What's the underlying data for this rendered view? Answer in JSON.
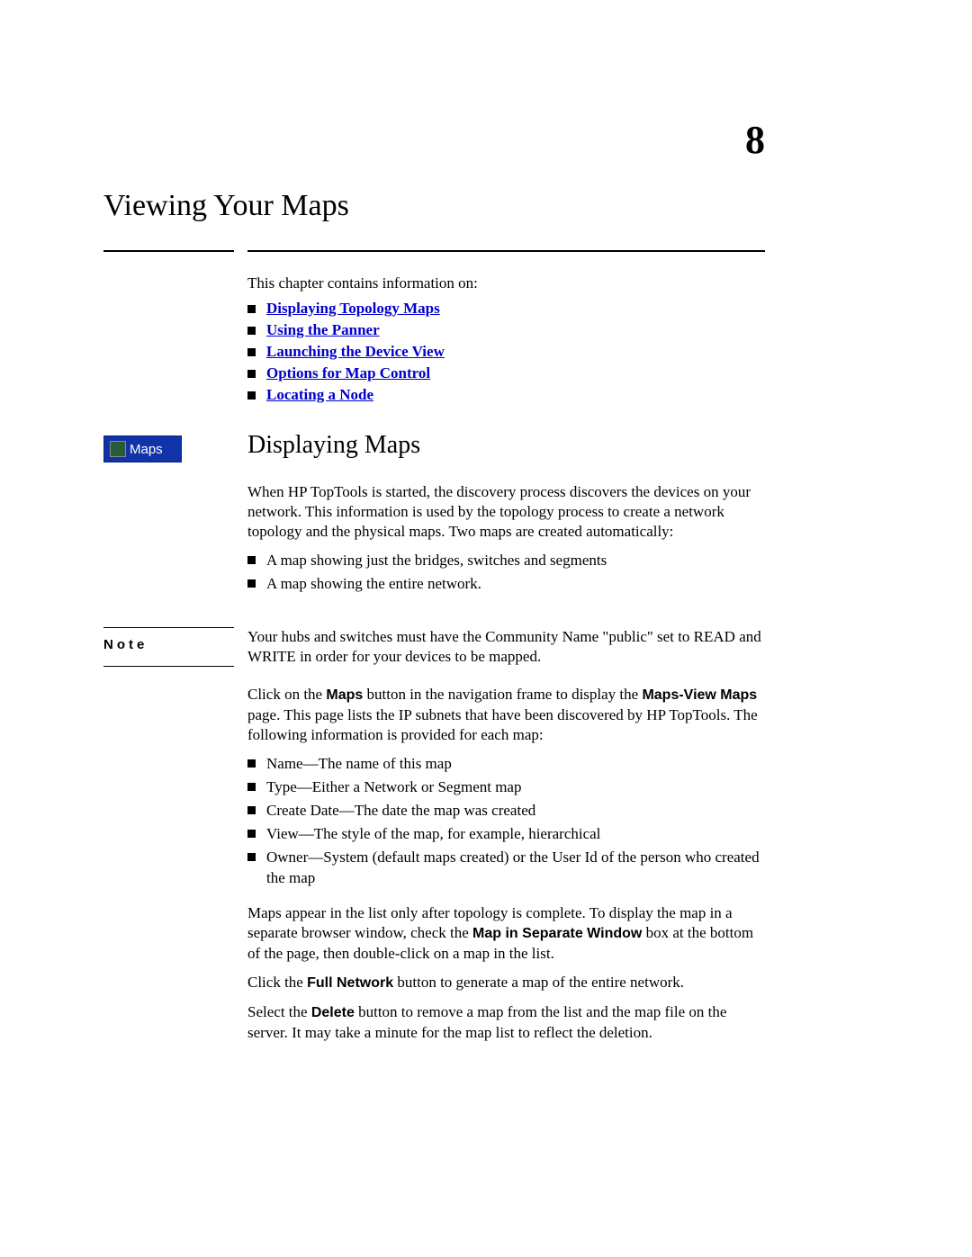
{
  "chapter_number": "8",
  "chapter_title": "Viewing Your Maps",
  "intro": "This chapter contains information on:",
  "links": [
    "Displaying Topology Maps",
    "Using the Panner",
    "Launching the Device View",
    "Options for Map Control",
    "Locating a Node"
  ],
  "section_title": "Displaying Maps",
  "maps_button_label": "Maps",
  "para1": "When HP TopTools is started, the discovery process discovers the devices on your network. This information is used by the topology process to create a network topology and the physical maps. Two maps are created automatically:",
  "list1": [
    "A map showing just the bridges, switches and segments",
    "A map showing the entire network."
  ],
  "note_label": "Note",
  "note_text": "Your hubs and switches must have the Community Name \"public\" set to READ and WRITE in order for your devices to be mapped.",
  "para2_pre": "Click on the ",
  "para2_bold1": "Maps",
  "para2_mid1": " button in the navigation frame to display the ",
  "para2_bold2": "Maps-View Maps",
  "para2_post": " page. This page lists the IP subnets that have been discovered by HP TopTools. The following information is provided for each map:",
  "list2": [
    "Name—The name of this map",
    "Type—Either a Network or Segment map",
    "Create Date—The date the map was created",
    "View—The style of the map, for example, hierarchical",
    "Owner—System (default maps created) or the User Id of the person who created the map"
  ],
  "para3_pre": "Maps appear in the list only after topology is complete. To display the map in a separate browser window, check the ",
  "para3_bold": "Map in Separate Window",
  "para3_post": " box at the bottom of the page, then double-click on a map in the list.",
  "para4_pre": "Click the ",
  "para4_bold": "Full Network",
  "para4_post": " button to generate a map of the entire network.",
  "para5_pre": "Select the ",
  "para5_bold": "Delete",
  "para5_post": " button to remove a map from the list and the map file on the server. It may take a minute for the map list to reflect the deletion."
}
